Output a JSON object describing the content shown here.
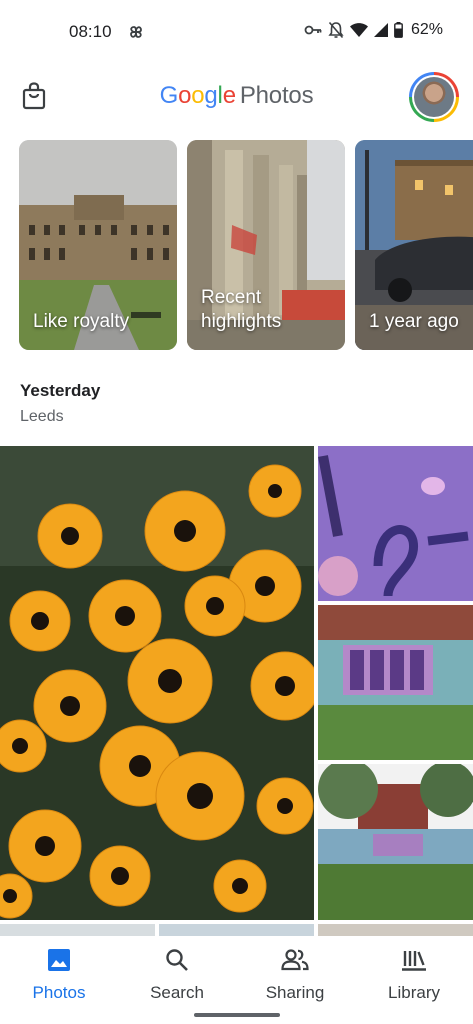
{
  "status_bar": {
    "time": "08:10",
    "battery": "62%",
    "icons": [
      "pinwheel-icon",
      "key-icon",
      "bell-off-icon",
      "wifi-icon",
      "signal-icon",
      "battery-icon"
    ]
  },
  "app_bar": {
    "logo_google": [
      "G",
      "o",
      "o",
      "g",
      "l",
      "e"
    ],
    "logo_product": "Photos",
    "left_icon": "shopping-bag-icon",
    "avatar_alt": "account-avatar"
  },
  "memories": [
    {
      "label": "Like royalty"
    },
    {
      "label": "Recent highlights"
    },
    {
      "label": "1 year ago"
    }
  ],
  "section": {
    "title": "Yesterday",
    "location": "Leeds"
  },
  "bottom_nav": {
    "items": [
      {
        "label": "Photos",
        "icon": "photos-icon",
        "active": true
      },
      {
        "label": "Search",
        "icon": "search-icon",
        "active": false
      },
      {
        "label": "Sharing",
        "icon": "sharing-icon",
        "active": false
      },
      {
        "label": "Library",
        "icon": "library-icon",
        "active": false
      }
    ]
  },
  "colors": {
    "accent": "#1a73e8",
    "google_blue": "#4285F4",
    "google_red": "#EA4335",
    "google_yellow": "#FBBC05",
    "google_green": "#34A853"
  }
}
